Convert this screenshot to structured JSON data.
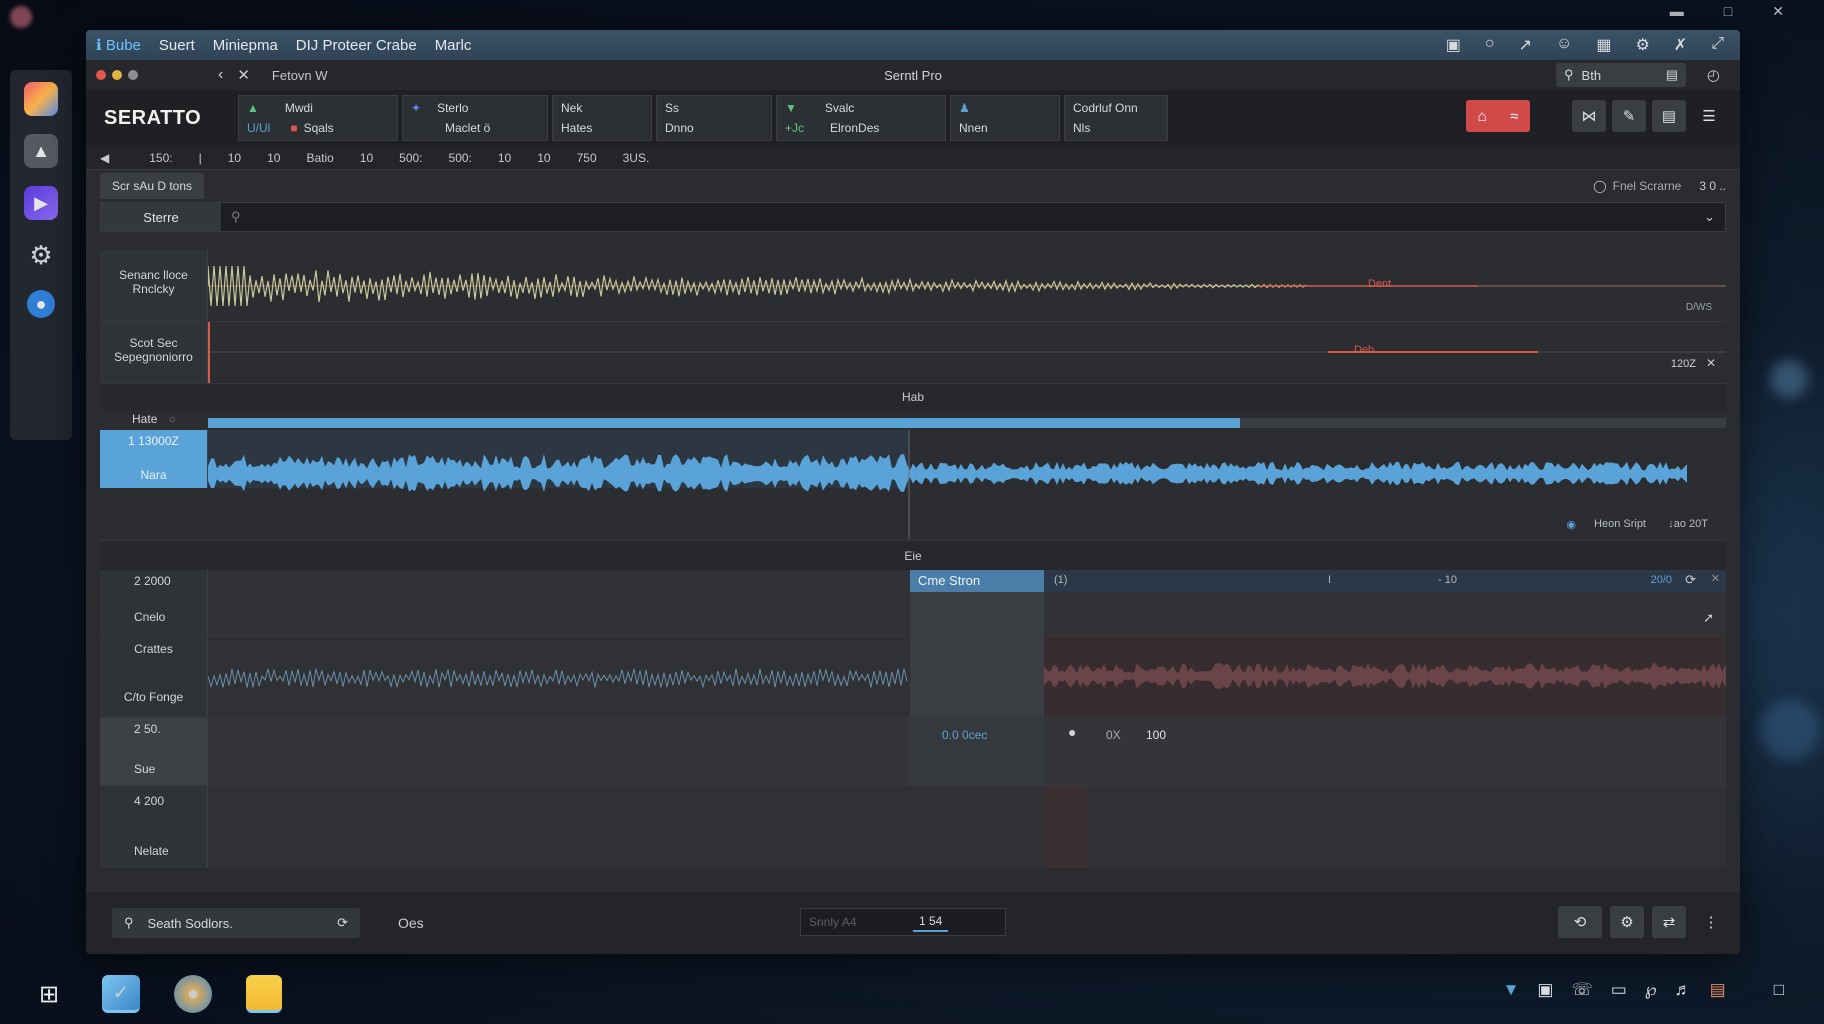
{
  "menubar": {
    "items": [
      "ℹ Bube",
      "Suert",
      "Miniepma",
      "DIJ Proteer Crabe",
      "Marlc"
    ]
  },
  "titlebar": {
    "nav_label": "Fetovn W",
    "title": "Serntl Pro",
    "search_value": "Bth"
  },
  "toolbar": {
    "logo": "SERATTO",
    "groups": [
      {
        "row1": "Mwdi",
        "row2": "Sqals",
        "extra": "U/Ul"
      },
      {
        "row1": "Sterlo",
        "row2": "Maclet ö"
      },
      {
        "row1": "Nek",
        "row2": "Hates"
      },
      {
        "row1": "Ss",
        "row2": "Dnno"
      },
      {
        "row1": "Svalc",
        "row2": "ElronDes",
        "extra": "+Jc"
      },
      {
        "row1": "",
        "row2": "Nnen"
      },
      {
        "row1": "Codrluf Onn",
        "row2": "Nls"
      }
    ]
  },
  "ruler": {
    "ticks": [
      "150:",
      "|",
      "10",
      "10",
      "Batio",
      "10",
      "500:",
      "500:",
      "10",
      "10",
      "750",
      "3US."
    ]
  },
  "panel": {
    "tab": "Scr sAu D tons",
    "right_label": "Fnel Scrarne",
    "right_value": "3 0 ..",
    "search_label": "Sterre"
  },
  "tracks": {
    "lane1_label": "Senanc lloce Rnclcky",
    "lane1_marker": "Dent",
    "lane1_right": "D/WS",
    "lane2_label": "Scot Sec Sepegnoniorro",
    "lane2_marker": "Deb",
    "lane2_right": "120Z",
    "section1_title": "Hab",
    "lane3_top": "Hate",
    "lane4_value": "1 13000Z",
    "lane4_label": "Nara",
    "lane4_footer": "Heon Sript",
    "lane4_footer_value": "↓ao 20T",
    "section2_title": "Eie",
    "lane5_value": "2 2000",
    "lane5_label": "Cnelo",
    "lane5_clip": "Cme Stron",
    "lane5_mid": "(1)",
    "lane5_bar": "I",
    "lane5_tag": "- 10",
    "lane5_end": "20/0",
    "lane6_label": "Crattes",
    "lane6_sub": "C/to Fonge",
    "lane7_value": "2 50.",
    "lane7_label": "Sue",
    "lane7_clip": "0.0 0cec",
    "lane7_pct": "0X",
    "lane7_num": "100",
    "lane8_value": "4 200",
    "lane8_label": "Nelate"
  },
  "bottom": {
    "search_label": "Seath Sodlors.",
    "ode_label": "Oes",
    "mid_placeholder": "Snnly A4",
    "mid_value": "1 54"
  },
  "colors": {
    "accent_blue": "#5aa3d8",
    "waveform_yellow": "#c8c89a",
    "marker_red": "#d85a4a",
    "record_red": "#d14a4a"
  }
}
